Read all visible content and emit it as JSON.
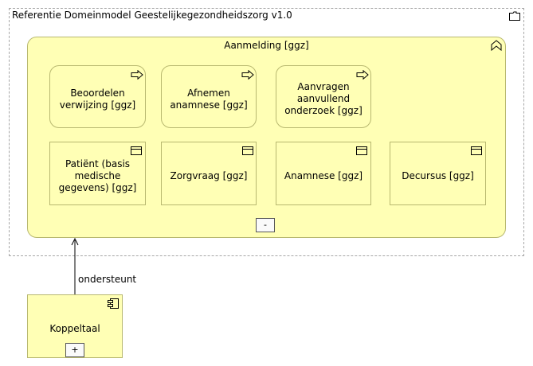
{
  "group": {
    "title": "Referentie Domeinmodel Geestelijkegezondheidszorg v1.0",
    "icon": "folder-icon"
  },
  "function": {
    "title": "Aanmelding [ggz]",
    "icon": "function-chevron-icon",
    "toggle": "-"
  },
  "processes": [
    {
      "label": "Beoordelen verwijzing [ggz]",
      "icon": "process-arrow-icon"
    },
    {
      "label": "Afnemen anamnese [ggz]",
      "icon": "process-arrow-icon"
    },
    {
      "label": "Aanvragen aanvullend onderzoek [ggz]",
      "icon": "process-arrow-icon"
    }
  ],
  "objects": [
    {
      "label": "Patiënt (basis medische gegevens) [ggz]",
      "icon": "data-object-icon"
    },
    {
      "label": "Zorgvraag [ggz]",
      "icon": "data-object-icon"
    },
    {
      "label": "Anamnese [ggz]",
      "icon": "data-object-icon"
    },
    {
      "label": "Decursus [ggz]",
      "icon": "data-object-icon"
    }
  ],
  "component": {
    "label": "Koppeltaal",
    "icon": "application-component-icon",
    "toggle": "+"
  },
  "relation": {
    "label": "ondersteunt"
  },
  "colors": {
    "fill": "#ffffb5",
    "border": "#b8b870",
    "group_border": "#a6a6a6"
  }
}
